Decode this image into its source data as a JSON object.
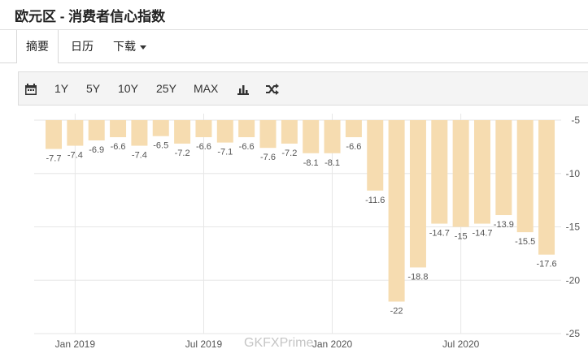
{
  "page": {
    "title": "欧元区 - 消费者信心指数"
  },
  "tabs": [
    {
      "label": "摘要",
      "active": true
    },
    {
      "label": "日历",
      "active": false
    },
    {
      "label": "下载",
      "active": false,
      "has_dropdown": true
    }
  ],
  "toolbar": {
    "calendar_icon": "calendar-icon",
    "ranges": [
      "1Y",
      "5Y",
      "10Y",
      "25Y",
      "MAX"
    ],
    "bar_chart_icon": "bar-chart-icon",
    "shuffle_icon": "shuffle-icon"
  },
  "watermark": "GKFXPrime",
  "chart_data": {
    "type": "bar",
    "bar_color": "#f6dcb0",
    "categories": [
      "2018-12",
      "2019-01",
      "2019-02",
      "2019-03",
      "2019-04",
      "2019-05",
      "2019-06",
      "2019-07",
      "2019-08",
      "2019-09",
      "2019-10",
      "2019-11",
      "2019-12",
      "2020-01",
      "2020-02",
      "2020-03",
      "2020-04",
      "2020-05",
      "2020-06",
      "2020-07",
      "2020-08",
      "2020-09",
      "2020-10",
      "2020-11",
      "2020-12"
    ],
    "values": [
      -7.7,
      -7.4,
      -6.9,
      -6.6,
      -7.4,
      -6.5,
      -7.2,
      -6.6,
      -7.1,
      -6.6,
      -7.6,
      -7.2,
      -8.1,
      -8.1,
      -6.6,
      -11.6,
      -22,
      -18.8,
      -14.7,
      -15,
      -14.7,
      -13.9,
      -15.5,
      -17.6
    ],
    "value_labels": [
      "-7.7",
      "-7.4",
      "-6.9",
      "-6.6",
      "-7.4",
      "-6.5",
      "-7.2",
      "-6.6",
      "-7.1",
      "-6.6",
      "-7.6",
      "-7.2",
      "-8.1",
      "-8.1",
      "-6.6",
      "-11.6",
      "-22",
      "-18.8",
      "-14.7",
      "-15",
      "-14.7",
      "-13.9",
      "-15.5",
      "-17.6"
    ],
    "x_ticks": [
      {
        "label": "Jan 2019",
        "index": 1
      },
      {
        "label": "Jul 2019",
        "index": 7
      },
      {
        "label": "Jan 2020",
        "index": 13
      },
      {
        "label": "Jul 2020",
        "index": 19
      }
    ],
    "y_ticks": [
      "-5",
      "-10",
      "-15",
      "-20",
      "-25"
    ],
    "y_axis_side": "right",
    "ylim": [
      -25,
      -5
    ],
    "grid": true
  }
}
